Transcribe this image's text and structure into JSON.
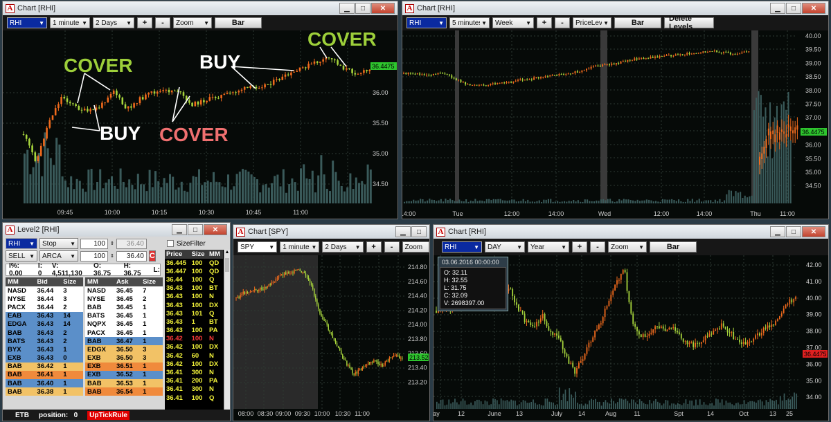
{
  "window1": {
    "title": "Chart [RHI]",
    "symbol": "RHI",
    "interval": "1 minute",
    "range": "2 Days",
    "plus": "+",
    "minus": "-",
    "mode": "Zoom",
    "style": "Bar",
    "price_labels": [
      "36.00",
      "35.50",
      "35.00",
      "34.50"
    ],
    "last_price": "36.4475",
    "time_labels": [
      "09:45",
      "10:00",
      "10:15",
      "10:30",
      "10:45",
      "11:00"
    ],
    "annotations": {
      "cover1": "COVER",
      "buy1": "BUY",
      "cover2": "COVER",
      "buy2": "BUY",
      "cover3": "COVER"
    },
    "colors": {
      "cover_green": "#9dcf3a",
      "cover_red": "#f07070",
      "buy": "#ffffff"
    }
  },
  "window2": {
    "title": "Chart [RHI]",
    "symbol": "RHI",
    "interval": "5 minutes",
    "range": "Week",
    "plus": "+",
    "minus": "-",
    "mode": "PriceLeve",
    "style": "Bar",
    "delete_levels": "Delete Levels",
    "price_labels": [
      "40.00",
      "39.50",
      "39.00",
      "38.50",
      "38.00",
      "37.50",
      "37.00",
      "36.50",
      "36.00",
      "35.50",
      "35.00",
      "34.50"
    ],
    "last_price": "36.4475",
    "time_labels": [
      "14:00",
      "Tue",
      "12:00",
      "14:00",
      "Wed",
      "12:00",
      "14:00",
      "Thu",
      "11:00"
    ]
  },
  "level2": {
    "title": "Level2 [RHI]",
    "symbol": "RHI",
    "order_type": "Stop",
    "qty1": "100",
    "price1": "36.40",
    "side": "SELL",
    "route": "ARCA",
    "qty2": "100",
    "price2": "36.40",
    "stats": {
      "pct": "I%: 0.00",
      "i": "I: 0",
      "v": "V: 4,511,130",
      "o": "O: 36.75",
      "h": "H: 36.75",
      "l": "L:"
    },
    "size_filter": "SizeFilter",
    "bid_headers": [
      "MM",
      "Bid",
      "Size"
    ],
    "ask_headers": [
      "MM",
      "Ask",
      "Size"
    ],
    "bids": [
      {
        "mm": "NASD",
        "price": "36.44",
        "size": "3"
      },
      {
        "mm": "NYSE",
        "price": "36.44",
        "size": "3"
      },
      {
        "mm": "PACX",
        "price": "36.44",
        "size": "2"
      },
      {
        "mm": "EAB",
        "price": "36.43",
        "size": "14"
      },
      {
        "mm": "EDGA",
        "price": "36.43",
        "size": "14"
      },
      {
        "mm": "BAB",
        "price": "36.43",
        "size": "2"
      },
      {
        "mm": "BATS",
        "price": "36.43",
        "size": "2"
      },
      {
        "mm": "BYX",
        "price": "36.43",
        "size": "1"
      },
      {
        "mm": "EXB",
        "price": "36.43",
        "size": "0"
      },
      {
        "mm": "BAB",
        "price": "36.42",
        "size": "1"
      },
      {
        "mm": "BAB",
        "price": "36.41",
        "size": "1"
      },
      {
        "mm": "BAB",
        "price": "36.40",
        "size": "1"
      },
      {
        "mm": "BAB",
        "price": "36.38",
        "size": "1"
      }
    ],
    "asks": [
      {
        "mm": "NASD",
        "price": "36.45",
        "size": "7"
      },
      {
        "mm": "NYSE",
        "price": "36.45",
        "size": "2"
      },
      {
        "mm": "BAB",
        "price": "36.45",
        "size": "1"
      },
      {
        "mm": "BATS",
        "price": "36.45",
        "size": "1"
      },
      {
        "mm": "NQPX",
        "price": "36.45",
        "size": "1"
      },
      {
        "mm": "PACX",
        "price": "36.45",
        "size": "1"
      },
      {
        "mm": "BAB",
        "price": "36.47",
        "size": "1"
      },
      {
        "mm": "EDGX",
        "price": "36.50",
        "size": "3"
      },
      {
        "mm": "EXB",
        "price": "36.50",
        "size": "3"
      },
      {
        "mm": "EXB",
        "price": "36.51",
        "size": "1"
      },
      {
        "mm": "EXB",
        "price": "36.52",
        "size": "1"
      },
      {
        "mm": "BAB",
        "price": "36.53",
        "size": "1"
      },
      {
        "mm": "BAB",
        "price": "36.54",
        "size": "1"
      }
    ],
    "ts_headers": [
      "Price",
      "Size",
      "MM"
    ],
    "trades": [
      {
        "price": "36.445",
        "size": "100",
        "mm": "QD"
      },
      {
        "price": "36.447",
        "size": "100",
        "mm": "QD"
      },
      {
        "price": "36.44",
        "size": "100",
        "mm": "Q"
      },
      {
        "price": "36.43",
        "size": "100",
        "mm": "BT"
      },
      {
        "price": "36.43",
        "size": "100",
        "mm": "N"
      },
      {
        "price": "36.43",
        "size": "100",
        "mm": "DX"
      },
      {
        "price": "36.43",
        "size": "101",
        "mm": "Q"
      },
      {
        "price": "36.43",
        "size": "1",
        "mm": "BT"
      },
      {
        "price": "36.43",
        "size": "100",
        "mm": "PA"
      },
      {
        "price": "36.42",
        "size": "100",
        "mm": "N"
      },
      {
        "price": "36.42",
        "size": "100",
        "mm": "DX"
      },
      {
        "price": "36.42",
        "size": "60",
        "mm": "N"
      },
      {
        "price": "36.42",
        "size": "100",
        "mm": "DX"
      },
      {
        "price": "36.41",
        "size": "300",
        "mm": "N"
      },
      {
        "price": "36.41",
        "size": "200",
        "mm": "PA"
      },
      {
        "price": "36.41",
        "size": "300",
        "mm": "N"
      },
      {
        "price": "36.41",
        "size": "100",
        "mm": "Q"
      }
    ],
    "status": {
      "etb": "ETB",
      "position_label": "position:",
      "position_value": "0",
      "uptick": "UpTickRule"
    },
    "c_button": "C"
  },
  "window3": {
    "title": "Chart [SPY]",
    "symbol": "SPY",
    "interval": "1 minute",
    "range": "2 Days",
    "plus": "+",
    "minus": "-",
    "mode": "Zoom",
    "price_labels": [
      "214.80",
      "214.60",
      "214.40",
      "214.20",
      "214.00",
      "213.80",
      "213.60",
      "213.40",
      "213.20"
    ],
    "last_price": "213.52",
    "time_labels": [
      "08:00",
      "08:30",
      "09:00",
      "09:30",
      "10:00",
      "10:30",
      "11:00"
    ]
  },
  "window4": {
    "title": "Chart [RHI]",
    "symbol": "RHI",
    "interval": "DAY",
    "range": "Year",
    "plus": "+",
    "minus": "-",
    "mode": "Zoom",
    "style": "Bar",
    "tooltip": {
      "date": "03.06.2016 00:00:00",
      "o": "O: 32.11",
      "h": "H: 32.55",
      "l": "L: 31.75",
      "c": "C: 32.09",
      "v": "V: 2698397.00"
    },
    "price_labels": [
      "42.00",
      "41.00",
      "40.00",
      "39.00",
      "38.00",
      "37.00",
      "36.00",
      "35.00",
      "34.00"
    ],
    "last_price": "36.4475",
    "time_labels": [
      "ay",
      "12",
      "June",
      "13",
      "July",
      "14",
      "Aug",
      "11",
      "Spt",
      "14",
      "Oct",
      "13",
      "25"
    ]
  }
}
